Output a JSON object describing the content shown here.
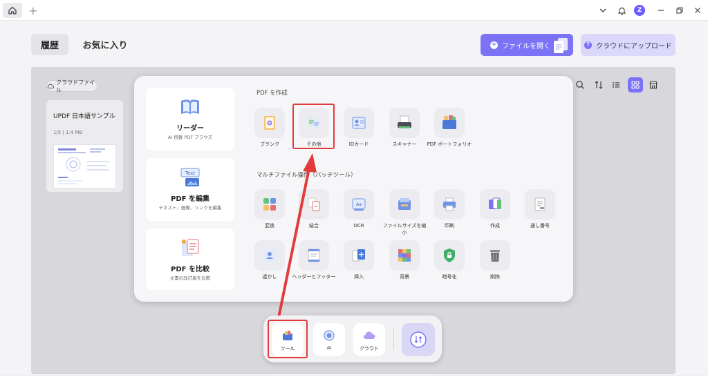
{
  "titlebar": {
    "add_tab": "+",
    "avatar_letter": "Z"
  },
  "tabs": {
    "history": "履歴",
    "favorites": "お気に入り"
  },
  "actions": {
    "open_file": "ファイルを開く",
    "upload_cloud": "クラウドにアップロード"
  },
  "sidebar": {
    "cloud_chip": "クラウドファイル",
    "file": {
      "title": "UPDF 日本語サンプル",
      "meta": "1/5 | 1.4 MB"
    }
  },
  "panel": {
    "cards": [
      {
        "title": "リーダー",
        "subtitle": "AI 搭載 PDF ブラウズ"
      },
      {
        "title": "PDF を編集",
        "subtitle": "テキスト、画像、リンクを編集"
      },
      {
        "title": "PDF を比較",
        "subtitle": "文書の改訂版を比較"
      }
    ],
    "create_section": "PDF を作成",
    "create_tools": [
      "ブランク",
      "その他",
      "IDカード",
      "スキャナー",
      "PDF ポートフォリオ"
    ],
    "multi_section": "マルチファイル操作（バッチツール）",
    "multi_tools_row1": [
      "変換",
      "結合",
      "OCR",
      "ファイルサイズを縮小",
      "印刷",
      "作成",
      "通し番号"
    ],
    "multi_tools_row2": [
      "透かし",
      "ヘッダーとフッター",
      "挿入",
      "背景",
      "暗号化",
      "削除"
    ]
  },
  "dock": {
    "tools": "ツール",
    "ai": "AI",
    "cloud": "クラウド"
  },
  "colors": {
    "accent": "#7b72f6",
    "highlight": "#e23b3b"
  }
}
